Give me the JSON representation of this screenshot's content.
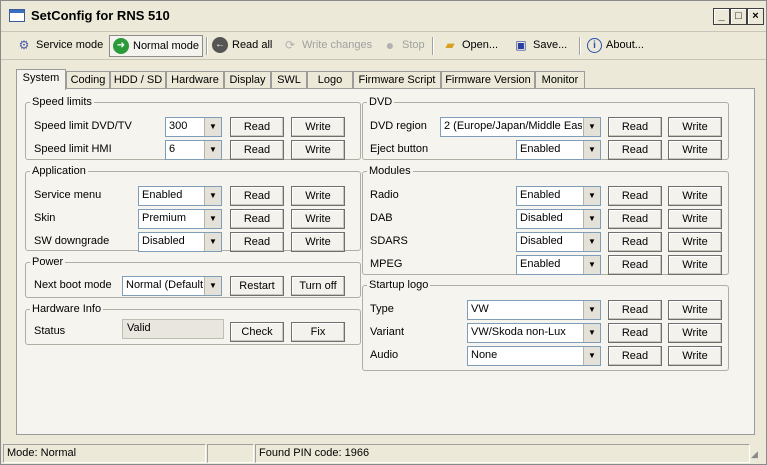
{
  "window": {
    "title": "SetConfig for RNS 510"
  },
  "toolbar": {
    "service_mode": "Service mode",
    "normal_mode": "Normal mode",
    "read_all": "Read all",
    "write_changes": "Write changes",
    "stop": "Stop",
    "open": "Open...",
    "save": "Save...",
    "about": "About..."
  },
  "tabs": [
    "System",
    "Coding",
    "HDD / SD",
    "Hardware",
    "Display",
    "SWL",
    "Logo",
    "Firmware Script",
    "Firmware Version",
    "Monitor"
  ],
  "buttons": {
    "read": "Read",
    "write": "Write",
    "restart": "Restart",
    "turn_off": "Turn off",
    "check": "Check",
    "fix": "Fix"
  },
  "speed_limits": {
    "title": "Speed limits",
    "dvd_tv_label": "Speed limit DVD/TV",
    "dvd_tv_value": "300",
    "hmi_label": "Speed limit HMI",
    "hmi_value": "6"
  },
  "application": {
    "title": "Application",
    "service_menu_label": "Service menu",
    "service_menu_value": "Enabled",
    "skin_label": "Skin",
    "skin_value": "Premium",
    "sw_downgrade_label": "SW downgrade",
    "sw_downgrade_value": "Disabled"
  },
  "power": {
    "title": "Power",
    "next_boot_label": "Next boot mode",
    "next_boot_value": "Normal (Default)"
  },
  "hardware_info": {
    "title": "Hardware Info",
    "status_label": "Status",
    "status_value": "Valid"
  },
  "dvd": {
    "title": "DVD",
    "region_label": "DVD region",
    "region_value": "2 (Europe/Japan/Middle East",
    "eject_label": "Eject button",
    "eject_value": "Enabled"
  },
  "modules": {
    "title": "Modules",
    "radio_label": "Radio",
    "radio_value": "Enabled",
    "dab_label": "DAB",
    "dab_value": "Disabled",
    "sdars_label": "SDARS",
    "sdars_value": "Disabled",
    "mpeg_label": "MPEG",
    "mpeg_value": "Enabled"
  },
  "startup_logo": {
    "title": "Startup logo",
    "type_label": "Type",
    "type_value": "VW",
    "variant_label": "Variant",
    "variant_value": "VW/Skoda non-Lux",
    "audio_label": "Audio",
    "audio_value": "None"
  },
  "statusbar": {
    "mode": "Mode: Normal",
    "middle": "",
    "pin": "Found PIN code: 1966"
  }
}
